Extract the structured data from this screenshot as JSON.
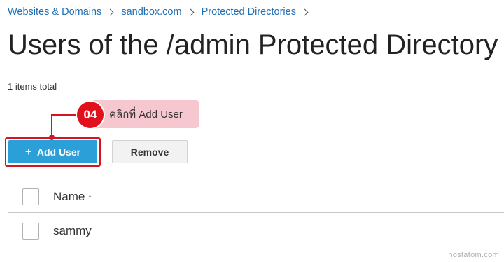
{
  "breadcrumb": [
    "Websites & Domains",
    "sandbox.com",
    "Protected Directories"
  ],
  "page": {
    "title": "Users of the /admin Protected Directory",
    "items_total": "1 items total"
  },
  "annotation": {
    "step": "04",
    "text": "คลิกที่ Add User",
    "color": "#e0101c",
    "background": "#f7c7cf"
  },
  "toolbar": {
    "add_icon": "+",
    "add_label": "Add User",
    "remove_label": "Remove",
    "accent": "#2b9fd8"
  },
  "table": {
    "columns": [
      {
        "label": "Name",
        "sort_icon": "↑"
      }
    ],
    "rows": [
      {
        "name": "sammy"
      }
    ]
  },
  "watermark": "hostatom.com"
}
